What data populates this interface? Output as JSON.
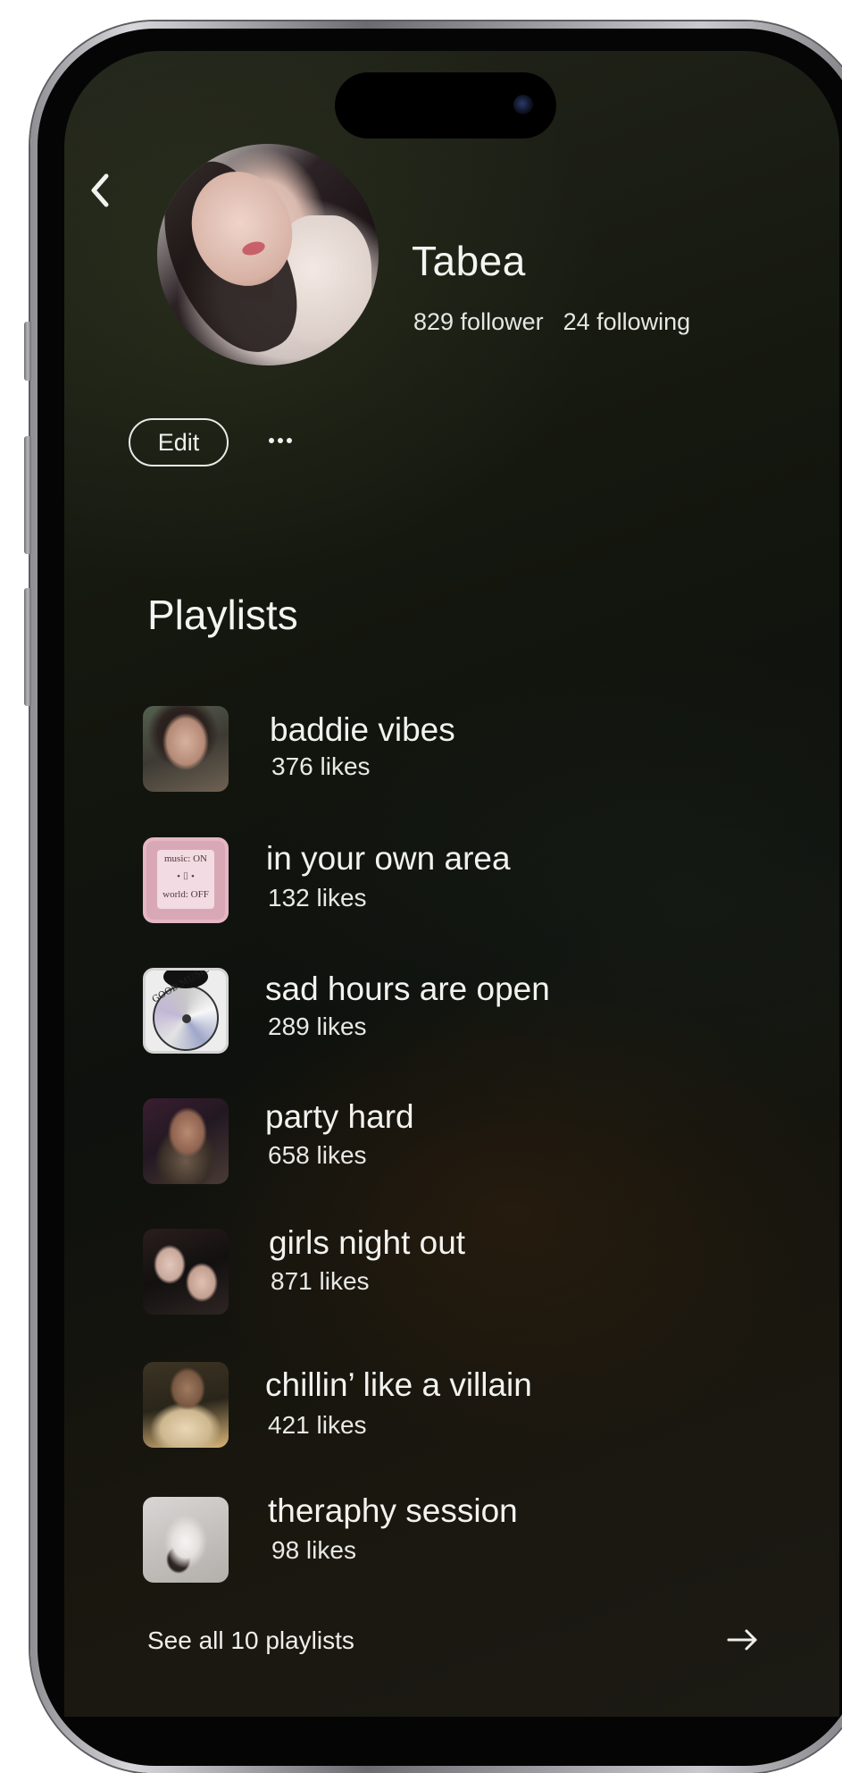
{
  "profile": {
    "name": "Tabea",
    "followers": "829 follower",
    "following": "24 following"
  },
  "actions": {
    "edit_label": "Edit",
    "more_label": "•••"
  },
  "playlists_section": {
    "title": "Playlists",
    "items": [
      {
        "title": "baddie vibes",
        "likes": "376 likes"
      },
      {
        "title": "in your own area",
        "likes": "132 likes"
      },
      {
        "title": "sad hours are open",
        "likes": "289 likes"
      },
      {
        "title": "party hard",
        "likes": "658 likes"
      },
      {
        "title": "girls night out",
        "likes": "871 likes"
      },
      {
        "title": "chillin’ like a villain",
        "likes": "421 likes"
      },
      {
        "title": "theraphy session",
        "likes": "98 likes"
      }
    ],
    "see_all_label": "See all 10 playlists"
  },
  "thumbnail_texts": {
    "music_on_world_off": [
      "music: ON",
      "world: OFF"
    ],
    "good_music_bad_days": "GOOD MUSIC BAD DAYS"
  },
  "icons": {
    "back": "chevron-left-icon",
    "more": "ellipsis-icon",
    "see_all": "arrow-right-icon"
  },
  "colors": {
    "text_primary": "#f4f4f2",
    "background_dark": "#0e110d"
  }
}
